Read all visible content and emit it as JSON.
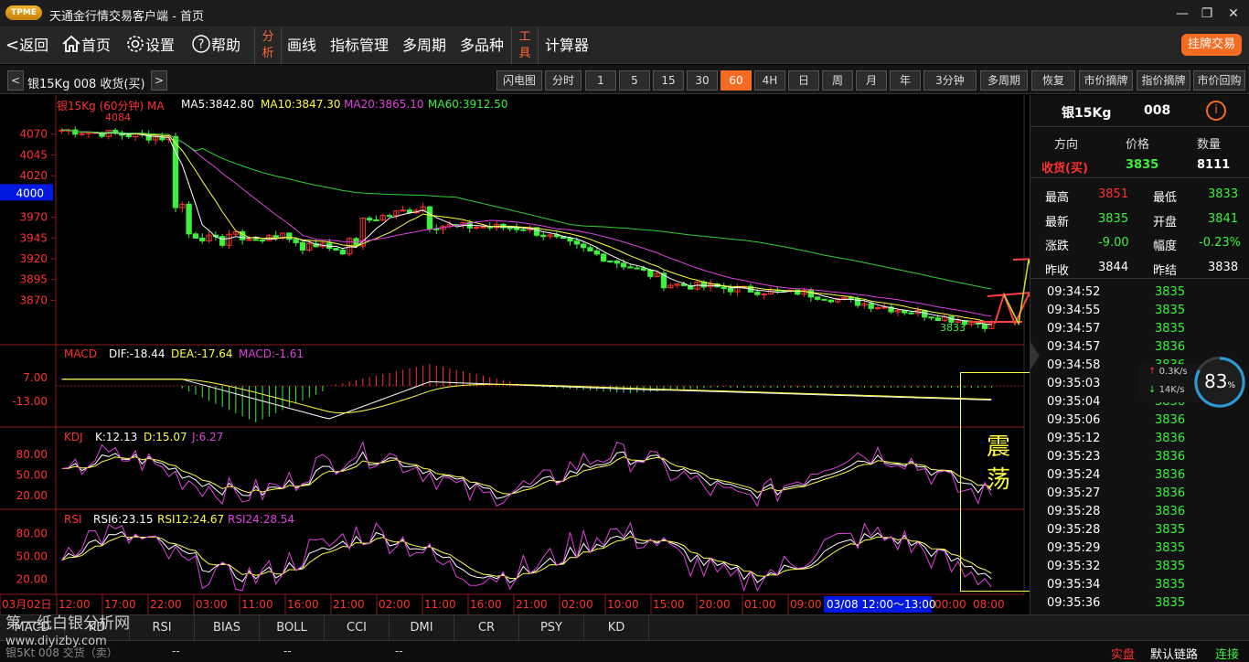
{
  "window": {
    "logo_text": "TPME",
    "title": "天通金行情交易客户端 - 首页",
    "minimize": "—",
    "restore": "❐",
    "close": "✕"
  },
  "toolbar": {
    "back": "返回",
    "home": "首页",
    "settings": "设置",
    "help": "帮助",
    "analysis_1": "分",
    "analysis_2": "析",
    "draw": "画线",
    "indicator": "指标管理",
    "multi_period": "多周期",
    "multi_variety": "多品种",
    "tools_1": "工",
    "tools_2": "具",
    "calculator": "计算器",
    "trade": "挂牌交易"
  },
  "periodbar": {
    "prev": "<",
    "next": ">",
    "instrument": "银15Kg 008 收货(买)",
    "buttons": [
      "闪电图",
      "分时",
      "1",
      "5",
      "15",
      "30",
      "60",
      "4H",
      "日",
      "周",
      "月",
      "年",
      "3分钟",
      "多周期",
      "恢复",
      "市价摘牌",
      "指价摘牌",
      "市价回购"
    ],
    "active": "60"
  },
  "main_chart": {
    "legend_name": "银15Kg  (60分钟) MA",
    "ma5": "MA5:3842.80",
    "ma10": "MA10:3847.30",
    "ma20": "MA20:3865.10",
    "ma60": "MA60:3912.50",
    "high_label": "4084",
    "low_label": "3833",
    "current_price": "4000",
    "y_ticks": [
      "4070",
      "4045",
      "4020",
      "3970",
      "3945",
      "3920",
      "3895",
      "3870"
    ]
  },
  "macd": {
    "name": "MACD",
    "dif": "DIF:-18.44",
    "dea": "DEA:-17.64",
    "macd": "MACD:-1.61",
    "y_ticks": [
      "7.00",
      "-13.00"
    ]
  },
  "kdj": {
    "name": "KDJ",
    "k": "K:12.13",
    "d": "D:15.07",
    "j": "J:6.27",
    "y_ticks": [
      "80.00",
      "50.00",
      "20.00"
    ]
  },
  "rsi": {
    "name": "RSI",
    "rsi6": "RSI6:23.15",
    "rsi12": "RSI12:24.67",
    "rsi24": "RSI24:28.54",
    "y_ticks": [
      "80.00",
      "50.00",
      "20.00"
    ]
  },
  "annotation": {
    "line1": "震",
    "line2": "荡"
  },
  "x_axis": {
    "start_label": "03月02日",
    "labels": [
      "12:00",
      "17:00",
      "22:00",
      "03:00",
      "11:00",
      "16:00",
      "21:00",
      "02:00",
      "11:00",
      "16:00",
      "21:00",
      "02:00",
      "10:00",
      "15:00",
      "20:00",
      "01:00",
      "09:00"
    ],
    "highlight": "03/08 12:00～13:00",
    "end_labels": [
      "00:00",
      "08:00"
    ]
  },
  "sidepanel": {
    "name": "银15Kg",
    "code": "008",
    "info_icon": "i",
    "col_direction": "方向",
    "col_price": "价格",
    "col_qty": "数量",
    "direction": "收货(买)",
    "price": "3835",
    "qty": "8111",
    "stats": [
      {
        "l1": "最高",
        "v1": "3851",
        "c1": "red",
        "l2": "最低",
        "v2": "3833",
        "c2": "green"
      },
      {
        "l1": "最新",
        "v1": "3835",
        "c1": "green",
        "l2": "开盘",
        "v2": "3841",
        "c2": "green"
      },
      {
        "l1": "涨跌",
        "v1": "-9.00",
        "c1": "green",
        "l2": "幅度",
        "v2": "-0.23%",
        "c2": "green"
      },
      {
        "l1": "昨收",
        "v1": "3844",
        "c1": "white",
        "l2": "昨结",
        "v2": "3838",
        "c2": "white"
      }
    ],
    "ticks": [
      {
        "t": "09:34:52",
        "p": "3835"
      },
      {
        "t": "09:34:55",
        "p": "3835"
      },
      {
        "t": "09:34:57",
        "p": "3835"
      },
      {
        "t": "09:34:57",
        "p": "3836"
      },
      {
        "t": "09:34:58",
        "p": "3836"
      },
      {
        "t": "09:35:03",
        "p": "3836"
      },
      {
        "t": "09:35:04",
        "p": "3836"
      },
      {
        "t": "09:35:06",
        "p": "3836"
      },
      {
        "t": "09:35:12",
        "p": "3836"
      },
      {
        "t": "09:35:23",
        "p": "3836"
      },
      {
        "t": "09:35:24",
        "p": "3836"
      },
      {
        "t": "09:35:27",
        "p": "3836"
      },
      {
        "t": "09:35:28",
        "p": "3836"
      },
      {
        "t": "09:35:28",
        "p": "3835"
      },
      {
        "t": "09:35:29",
        "p": "3835"
      },
      {
        "t": "09:35:32",
        "p": "3835"
      },
      {
        "t": "09:35:34",
        "p": "3835"
      },
      {
        "t": "09:35:36",
        "p": "3835"
      }
    ]
  },
  "net_meter": {
    "up": "0.3K/s",
    "down": "14K/s",
    "percent": "83",
    "unit": "%"
  },
  "tabs": [
    "MACD",
    "KD",
    "RSI",
    "BIAS",
    "BOLL",
    "CCI",
    "DMI",
    "CR",
    "PSY",
    "KD"
  ],
  "statusbar": {
    "instrument": "银5Kt 008 交货（卖）",
    "dash1": "--",
    "dash2": "--",
    "dash3": "--",
    "mode": "实盘",
    "link": "默认链路",
    "state": "连接"
  },
  "watermark": {
    "line1": "第一纸白银分析网",
    "line2": "www.diyizby.com"
  },
  "colors": {
    "accent": "#f46b21",
    "up": "#ff3030",
    "down": "#3cf03c",
    "ma5": "#ffffff",
    "ma10": "#ffff40",
    "ma20": "#e040e0",
    "ma60": "#30d030"
  }
}
